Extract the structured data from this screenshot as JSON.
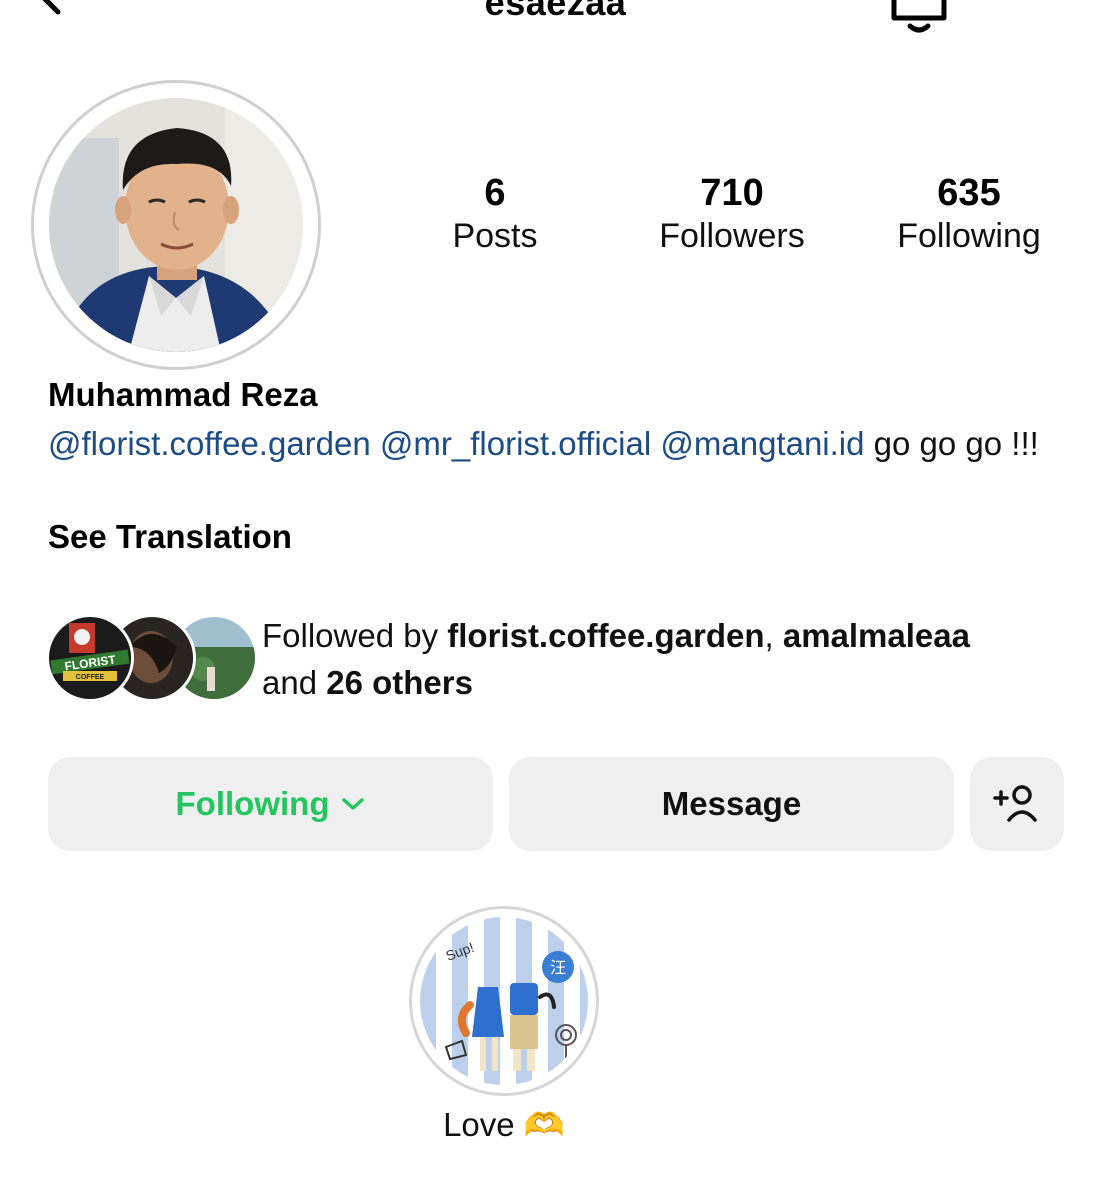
{
  "header": {
    "username": "esaezaa",
    "back_icon": "chevron-left-icon",
    "bell_icon": "bell-icon",
    "more_icon": "more-horizontal-icon"
  },
  "profile": {
    "avatar_icon": "profile-photo",
    "stats": [
      {
        "count": "6",
        "label": "Posts"
      },
      {
        "count": "710",
        "label": "Followers"
      },
      {
        "count": "635",
        "label": "Following"
      }
    ],
    "full_name": "Muhammad Reza",
    "bio": {
      "mentions": [
        "@florist.coffee.garden",
        "@mr_florist.official",
        "@mangtani.id"
      ],
      "text_after": "go go go !!!"
    },
    "see_translation": "See Translation"
  },
  "followed_by": {
    "prefix": "Followed by ",
    "names": [
      "florist.coffee.garden",
      "amalmaleaa"
    ],
    "and": "and ",
    "others": "26 others",
    "avatar_texts": [
      "FLORIST",
      "COFFEE"
    ]
  },
  "actions": {
    "following_label": "Following",
    "message_label": "Message",
    "add_person_icon": "add-person-icon",
    "accent_color": "#22c55e"
  },
  "highlights": [
    {
      "label": "Love",
      "emoji": "🫶",
      "sticker_texts": [
        "Sup!",
        "汪"
      ]
    }
  ]
}
